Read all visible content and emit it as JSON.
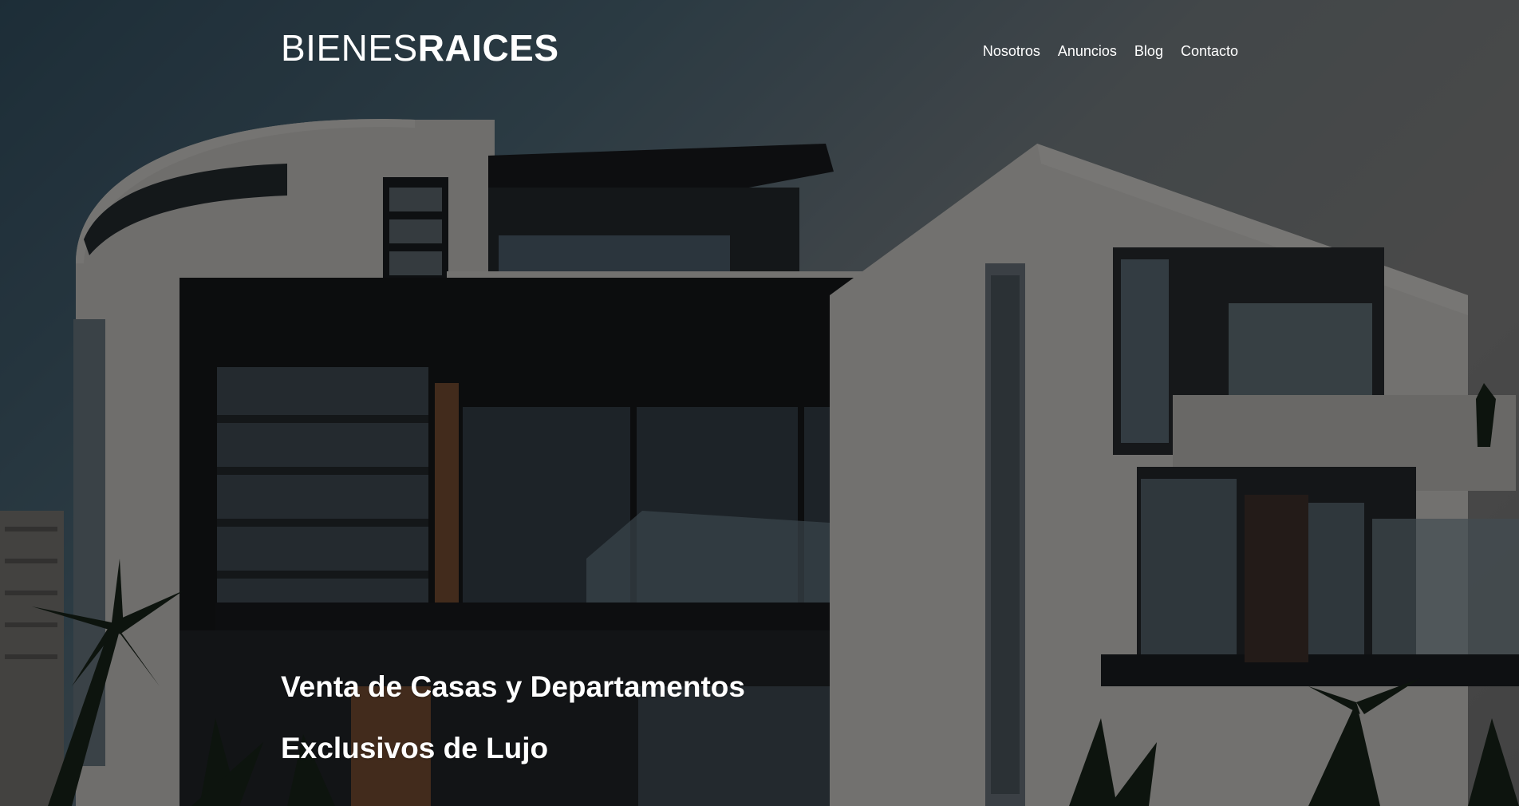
{
  "header": {
    "logo_light": "BIENES",
    "logo_bold": "RAICES",
    "nav": [
      {
        "label": "Nosotros"
      },
      {
        "label": "Anuncios"
      },
      {
        "label": "Blog"
      },
      {
        "label": "Contacto"
      }
    ]
  },
  "hero": {
    "line1": "Venta de Casas y Departamentos",
    "line2": "Exclusivos de Lujo"
  },
  "colors": {
    "text": "#ffffff",
    "overlay": "rgba(0,0,0,0.52)"
  }
}
